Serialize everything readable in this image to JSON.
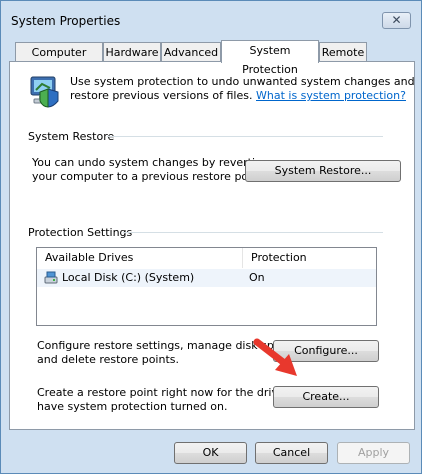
{
  "window": {
    "title": "System Properties",
    "close_glyph": "✕"
  },
  "tabs": [
    {
      "label": "Computer Name",
      "active": false
    },
    {
      "label": "Hardware",
      "active": false
    },
    {
      "label": "Advanced",
      "active": false
    },
    {
      "label": "System Protection",
      "active": true
    },
    {
      "label": "Remote",
      "active": false
    }
  ],
  "intro": {
    "icon": "shield-computer-icon",
    "text_line1": "Use system protection to undo unwanted system changes and",
    "text_line2_prefix": "restore previous versions of files. ",
    "link": "What is system protection?"
  },
  "system_restore": {
    "heading": "System Restore",
    "desc_line1": "You can undo system changes by reverting",
    "desc_line2": "your computer to a previous restore point.",
    "button": "System Restore..."
  },
  "protection": {
    "heading": "Protection Settings",
    "columns": [
      "Available Drives",
      "Protection"
    ],
    "drives": [
      {
        "name": "Local Disk (C:) (System)",
        "protection": "On",
        "icon": "drive-icon"
      }
    ],
    "configure_line1": "Configure restore settings, manage disk space,",
    "configure_line2": "and delete restore points.",
    "configure_button": "Configure...",
    "create_line1": "Create a restore point right now for the drives that",
    "create_line2": "have system protection turned on.",
    "create_button": "Create..."
  },
  "footer": {
    "ok": "OK",
    "cancel": "Cancel",
    "apply": "Apply"
  },
  "colors": {
    "accent_link": "#0066cc",
    "arrow": "#e8382d"
  }
}
